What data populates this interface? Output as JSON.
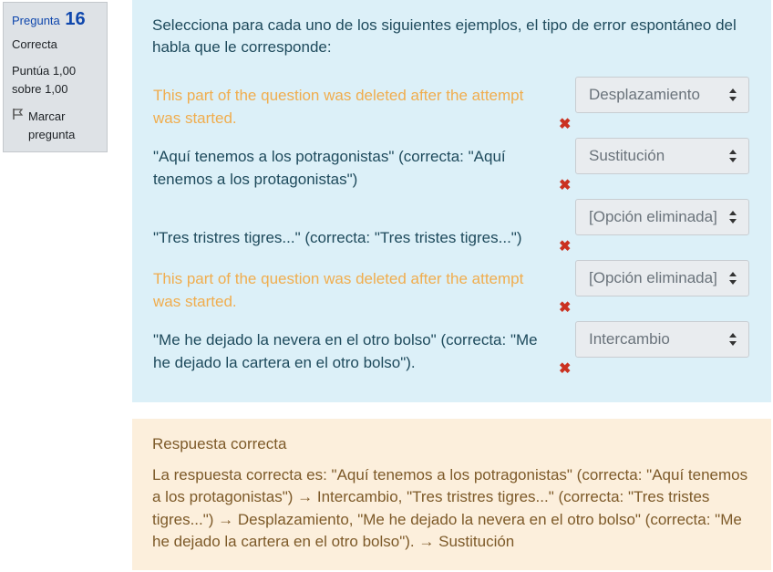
{
  "info": {
    "question_label": "Pregunta",
    "question_number": "16",
    "state": "Correcta",
    "grade": "Puntúa 1,00 sobre 1,00",
    "flag_label": "Marcar pregunta"
  },
  "question": {
    "text": "Selecciona para cada uno de los siguientes ejemplos, el tipo de error espontáneo del habla que le corresponde:",
    "rows": [
      {
        "label": "This part of the question was deleted after the attempt was started.",
        "selected": "Desplazamiento"
      },
      {
        "label": "\"Aquí tenemos a los potragonistas\" (correcta: \"Aquí tenemos a los protagonistas\")",
        "selected": "Sustitución"
      },
      {
        "label": "\"Tres tristres tigres...\" (correcta: \"Tres tristes tigres...\")",
        "selected": "[Opción eliminada]"
      },
      {
        "label": "This part of the question was deleted after the attempt was started.",
        "selected": "[Opción eliminada]"
      },
      {
        "label": "\"Me he dejado la nevera en el otro bolso\" (correcta: \"Me he dejado la cartera en el otro bolso\").",
        "selected": "Intercambio"
      }
    ]
  },
  "feedback": {
    "title": "Respuesta correcta",
    "answer": "La respuesta correcta es: \"Aquí tenemos a los potragonistas\" (correcta: \"Aquí tenemos a los protagonistas\") → Intercambio, \"Tres tristres tigres...\" (correcta: \"Tres tristes tigres...\") → Desplazamiento, \"Me he dejado la nevera en el otro bolso\" (correcta: \"Me he dejado la cartera en el otro bolso\"). → Sustitución"
  },
  "colors": {
    "question_bg": "#dcf0f8",
    "feedback_bg": "#fcefdc",
    "deleted_text": "#f0ad4e",
    "incorrect_icon": "#ca3120"
  },
  "icons": {
    "flag": "flag-icon",
    "incorrect": "incorrect-x-icon",
    "select_arrows": "sort-arrows-icon"
  }
}
